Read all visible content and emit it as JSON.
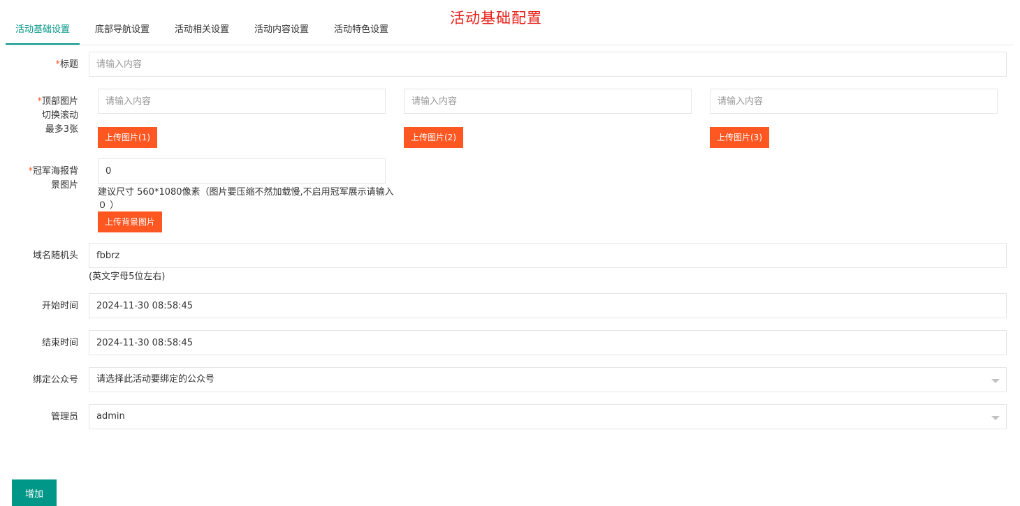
{
  "header": {
    "title": "活动基础配置"
  },
  "tabs": [
    {
      "label": "活动基础设置",
      "active": true
    },
    {
      "label": "底部导航设置"
    },
    {
      "label": "活动相关设置"
    },
    {
      "label": "活动内容设置"
    },
    {
      "label": "活动特色设置"
    }
  ],
  "form": {
    "required_mark": "*",
    "title_field": {
      "label": "标题",
      "value": "",
      "placeholder": "请输入内容"
    },
    "top_images": {
      "label_line1": "顶部图片",
      "label_line2": "切换滚动",
      "label_line3": "最多3张",
      "inputs": [
        {
          "value": "",
          "placeholder": "请输入内容",
          "upload_label": "上传图片(1)"
        },
        {
          "value": "",
          "placeholder": "请输入内容",
          "upload_label": "上传图片(2)"
        },
        {
          "value": "",
          "placeholder": "请输入内容",
          "upload_label": "上传图片(3)"
        }
      ]
    },
    "poster_bg": {
      "label_line1": "冠军海报背",
      "label_line2": "景图片",
      "value": "0",
      "hint": "建议尺寸 560*1080像素（图片要压缩不然加载慢,不启用冠军展示请输入０ ）",
      "upload_label": "上传背景图片"
    },
    "domain_prefix": {
      "label": "域名随机头",
      "value": "fbbrz",
      "hint": "(英文字母5位左右)"
    },
    "start_time": {
      "label": "开始时间",
      "value": "2024-11-30 08:58:45"
    },
    "end_time": {
      "label": "结束时间",
      "value": "2024-11-30 08:58:45"
    },
    "official_account": {
      "label": "绑定公众号",
      "selected": "请选择此活动要绑定的公众号"
    },
    "admin": {
      "label": "管理员",
      "selected": "admin"
    },
    "submit_label": "增加"
  },
  "colors": {
    "accent": "#009688",
    "upload": "#ff5722",
    "title": "#e8211a"
  }
}
